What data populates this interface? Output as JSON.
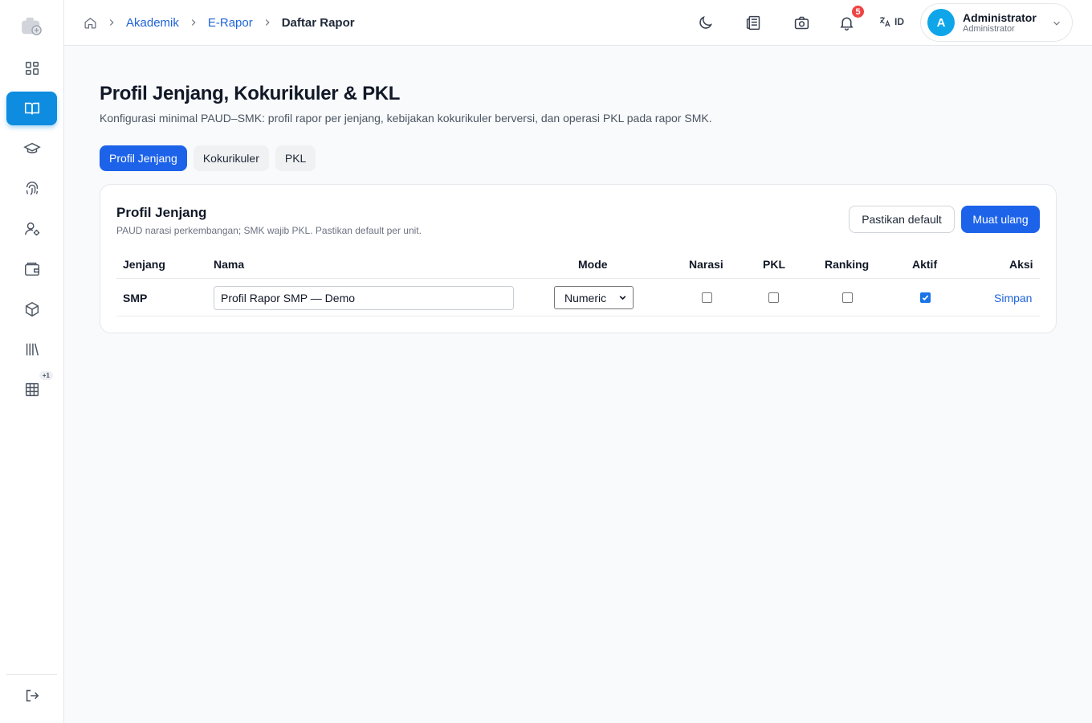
{
  "breadcrumb": {
    "items": [
      "Akademik",
      "E-Rapor"
    ],
    "current": "Daftar Rapor"
  },
  "header": {
    "notification_count": "5",
    "language": "ID",
    "user": {
      "initial": "A",
      "name": "Administrator",
      "role": "Administrator"
    }
  },
  "sidebar": {
    "badge": "+1",
    "active_index": 1
  },
  "page": {
    "title": "Profil Jenjang, Kokurikuler & PKL",
    "subtitle": "Konfigurasi minimal PAUD–SMK: profil rapor per jenjang, kebijakan kokurikuler berversi, dan operasi PKL pada rapor SMK.",
    "tabs": [
      {
        "label": "Profil Jenjang",
        "active": true
      },
      {
        "label": "Kokurikuler",
        "active": false
      },
      {
        "label": "PKL",
        "active": false
      }
    ]
  },
  "card": {
    "title": "Profil Jenjang",
    "subtitle": "PAUD narasi perkembangan; SMK wajib PKL. Pastikan default per unit.",
    "buttons": {
      "ensure_default": "Pastikan default",
      "reload": "Muat ulang"
    },
    "columns": [
      "Jenjang",
      "Nama",
      "Mode",
      "Narasi",
      "PKL",
      "Ranking",
      "Aktif",
      "Aksi"
    ],
    "rows": [
      {
        "jenjang": "SMP",
        "nama": "Profil Rapor SMP — Demo",
        "mode": "Numeric",
        "narasi": false,
        "pkl": false,
        "ranking": false,
        "aktif": true,
        "aksi": "Simpan"
      }
    ]
  },
  "colors": {
    "primary": "#1d63ea",
    "sidebar_active": "#0d8ce0",
    "badge": "#ef4444",
    "avatar": "#0ea5e9",
    "link": "#1d63d8"
  }
}
